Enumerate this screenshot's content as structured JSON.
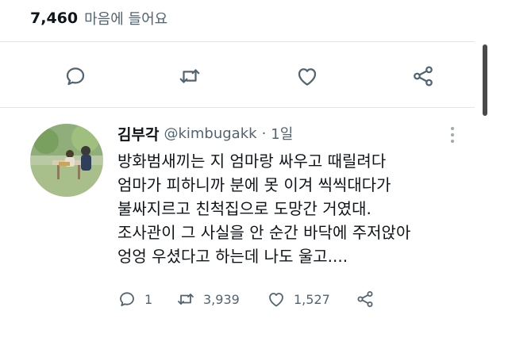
{
  "stats": {
    "likes_count": "7,460",
    "likes_label": "마음에 들어요"
  },
  "action_bar": {
    "icons": [
      "reply-icon",
      "retweet-icon",
      "like-icon",
      "share-icon"
    ]
  },
  "reply": {
    "author_name": "김부각",
    "author_handle": "@kimbugakk",
    "separator": "·",
    "time": "1일",
    "text_lines": [
      "방화범새끼는 지 엄마랑 싸우고 때릴려다",
      "엄마가 피하니까 분에 못 이겨 씩씩대다가",
      "불싸지르고 친척집으로 도망간 거였대.",
      "조사관이 그 사실을 안 순간 바닥에 주저앉아",
      "엉엉 우셨다고 하는데 나도 울고...."
    ],
    "reply_count": "1",
    "retweet_count": "3,939",
    "like_count": "1,527"
  },
  "colors": {
    "text_primary": "#0f1419",
    "text_secondary": "#536471",
    "icon": "#536471",
    "divider": "#e3e6e8"
  }
}
